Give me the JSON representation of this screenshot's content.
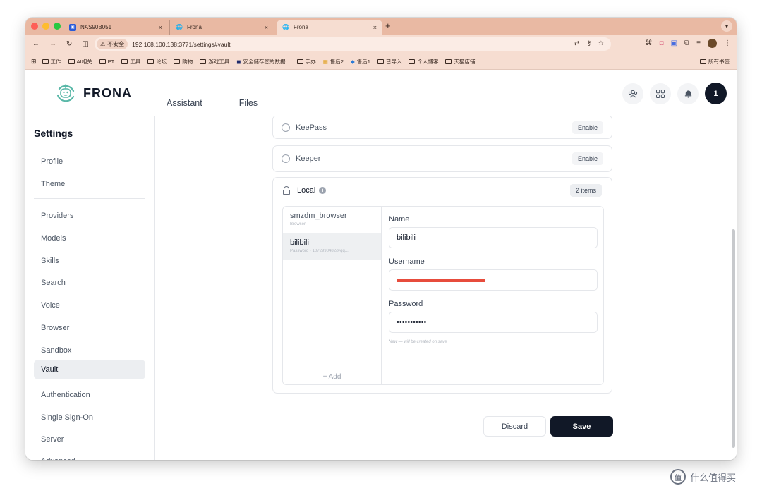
{
  "browser": {
    "tabs": [
      {
        "title": "NAS90B051",
        "close": "×"
      },
      {
        "title": "Frona",
        "close": "×"
      },
      {
        "title": "Frona",
        "close": "×"
      }
    ],
    "new_tab": "+",
    "url": {
      "security_label": "不安全",
      "address": "192.168.100.138:3771/settings#vault"
    },
    "bookmarks": [
      "工作",
      "AI相关",
      "PT",
      "工具",
      "论坛",
      "购物",
      "游戏工具",
      "安全储存您的数据...",
      "手办",
      "售后2",
      "售后1",
      "已导入",
      "个人博客",
      "天猫店铺"
    ],
    "bookmarks_right": "所有书签"
  },
  "app": {
    "logo_text": "FRONA",
    "nav": {
      "assistant": "Assistant",
      "files": "Files"
    },
    "user_initial": "1"
  },
  "sidebar": {
    "title": "Settings",
    "group1": [
      "Profile",
      "Theme"
    ],
    "group2": [
      "Providers",
      "Models",
      "Skills",
      "Search",
      "Voice",
      "Browser",
      "Sandbox",
      "Vault",
      "Authentication",
      "Single Sign-On",
      "Server",
      "Advanced"
    ],
    "active": "Vault"
  },
  "vault": {
    "providers": [
      {
        "name": "KeePass",
        "action": "Enable",
        "icon": "keepass-icon"
      },
      {
        "name": "Keeper",
        "action": "Enable",
        "icon": "keeper-icon"
      }
    ],
    "local": {
      "title": "Local",
      "count_badge": "2 items",
      "entries": [
        {
          "name": "smzdm_browser",
          "sub": "Browser"
        },
        {
          "name": "bilibili",
          "sub": "Password · 1072990482@qq..."
        }
      ],
      "add_label": "+ Add",
      "form": {
        "name_label": "Name",
        "name_value": "bilibili",
        "username_label": "Username",
        "password_label": "Password",
        "password_value": "•••••••••••",
        "note": "New — will be created on save"
      }
    }
  },
  "actions": {
    "discard": "Discard",
    "save": "Save"
  },
  "watermark": {
    "text": "什么值得买",
    "logo": "值"
  }
}
